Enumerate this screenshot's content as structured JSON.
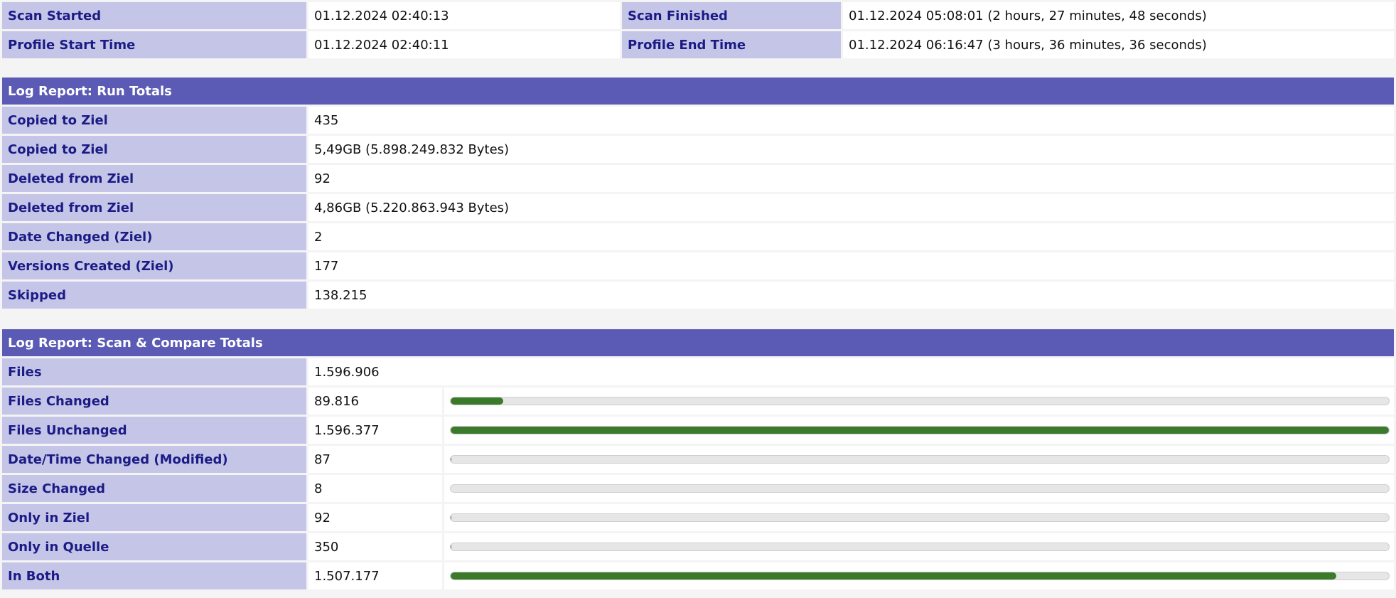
{
  "times": {
    "scan_started_label": "Scan Started",
    "scan_started_value": "01.12.2024 02:40:13",
    "scan_finished_label": "Scan Finished",
    "scan_finished_value": "01.12.2024 05:08:01 (2 hours, 27 minutes, 48 seconds)",
    "profile_start_label": "Profile Start Time",
    "profile_start_value": "01.12.2024 02:40:11",
    "profile_end_label": "Profile End Time",
    "profile_end_value": "01.12.2024 06:16:47 (3 hours, 36 minutes, 36 seconds)"
  },
  "run_totals": {
    "title": "Log Report: Run Totals",
    "rows": [
      {
        "label": "Copied to Ziel",
        "value": "435"
      },
      {
        "label": "Copied to Ziel",
        "value": "5,49GB (5.898.249.832 Bytes)"
      },
      {
        "label": "Deleted from Ziel",
        "value": "92"
      },
      {
        "label": "Deleted from Ziel",
        "value": "4,86GB (5.220.863.943 Bytes)"
      },
      {
        "label": "Date Changed (Ziel)",
        "value": "2"
      },
      {
        "label": "Versions Created (Ziel)",
        "value": "177"
      },
      {
        "label": "Skipped",
        "value": "138.215"
      }
    ]
  },
  "scan_totals": {
    "title": "Log Report: Scan & Compare Totals",
    "files_label": "Files",
    "files_value": "1.596.906",
    "rows": [
      {
        "label": "Files Changed",
        "value": "89.816",
        "fraction": 0.0562
      },
      {
        "label": "Files Unchanged",
        "value": "1.596.377",
        "fraction": 0.9997
      },
      {
        "label": "Date/Time Changed (Modified)",
        "value": "87",
        "fraction": 0.0001
      },
      {
        "label": "Size Changed",
        "value": "8",
        "fraction": 0.0
      },
      {
        "label": "Only in Ziel",
        "value": "92",
        "fraction": 0.0001
      },
      {
        "label": "Only in Quelle",
        "value": "350",
        "fraction": 0.0002
      },
      {
        "label": "In Both",
        "value": "1.507.177",
        "fraction": 0.9438
      }
    ]
  },
  "colors": {
    "header_bg": "#5b5bb5",
    "label_bg": "#c5c5e8",
    "label_text": "#1b1b86",
    "bar_fill": "#3b7a2a",
    "bar_track": "#e6e6e6"
  }
}
